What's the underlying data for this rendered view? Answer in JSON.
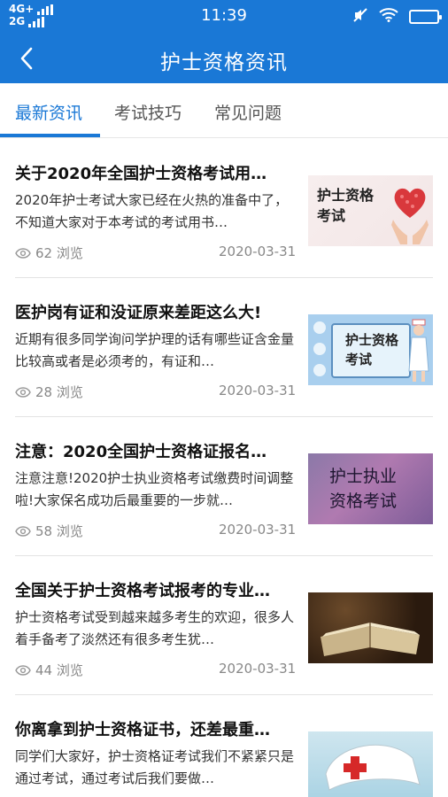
{
  "status_bar": {
    "network_top": "4G+",
    "network_bottom": "2G",
    "time": "11:39"
  },
  "navbar": {
    "title": "护士资格资讯"
  },
  "tabs": [
    {
      "label": "最新资讯",
      "active": true
    },
    {
      "label": "考试技巧",
      "active": false
    },
    {
      "label": "常见问题",
      "active": false
    }
  ],
  "articles": [
    {
      "title": "关于2020年全国护士资格考试用…",
      "summary": "2020年护士考试大家已经在火热的准备中了，不知道大家对于本考试的考试用书…",
      "views": "62 浏览",
      "date": "2020-03-31",
      "thumb_lines": [
        "护士资格",
        "考试"
      ]
    },
    {
      "title": "医护岗有证和没证原来差距这么大!",
      "summary": "近期有很多同学询问学护理的话有哪些证含金量比较高或者是必须考的，有证和…",
      "views": "28 浏览",
      "date": "2020-03-31",
      "thumb_lines": [
        "护士资格",
        "考试"
      ]
    },
    {
      "title": "注意：2020全国护士资格证报名…",
      "summary": "注意注意!2020护士执业资格考试缴费时间调整啦!大家保名成功后最重要的一步就…",
      "views": "58 浏览",
      "date": "2020-03-31",
      "thumb_lines": [
        "护士执业",
        "资格考试"
      ]
    },
    {
      "title": "全国关于护士资格考试报考的专业…",
      "summary": "护士资格考试受到越来越多考生的欢迎，很多人着手备考了淡然还有很多考生犹…",
      "views": "44 浏览",
      "date": "2020-03-31",
      "thumb_lines": []
    },
    {
      "title": "你离拿到护士资格证书，还差最重…",
      "summary": "同学们大家好，护士资格证考试我们不紧紧只是通过考试，通过考试后我们要做…",
      "views": "",
      "date": "",
      "thumb_lines": []
    }
  ],
  "colors": {
    "primary": "#1a78d6",
    "muted_text": "#888888"
  }
}
